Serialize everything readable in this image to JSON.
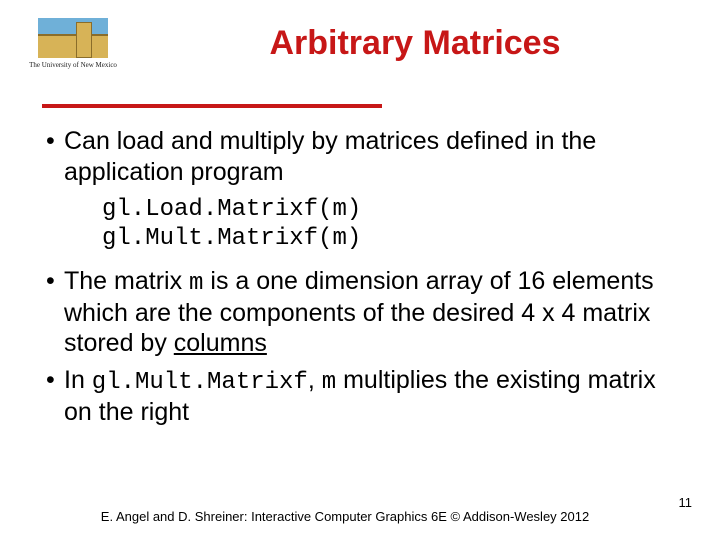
{
  "logo": {
    "caption": "The University of New Mexico",
    "icon": "unm-building-icon"
  },
  "title": "Arbitrary Matrices",
  "bullets": {
    "b1": "Can load and multiply by matrices defined in the application program",
    "code1": "gl.Load.Matrixf(m)",
    "code2": "gl.Mult.Matrixf(m)",
    "b2_pre": "The matrix ",
    "b2_m": "m",
    "b2_mid": " is a one dimension array of 16 elements which are the components of the desired 4 x 4 matrix stored by ",
    "b2_underlined": "columns",
    "b3_pre": "In ",
    "b3_code": "gl.Mult.Matrixf",
    "b3_mid": ", ",
    "b3_m": "m",
    "b3_post": " multiplies the existing matrix on the right"
  },
  "footer": "E. Angel and D. Shreiner: Interactive Computer Graphics 6E © Addison-Wesley 2012",
  "page_number": "11"
}
